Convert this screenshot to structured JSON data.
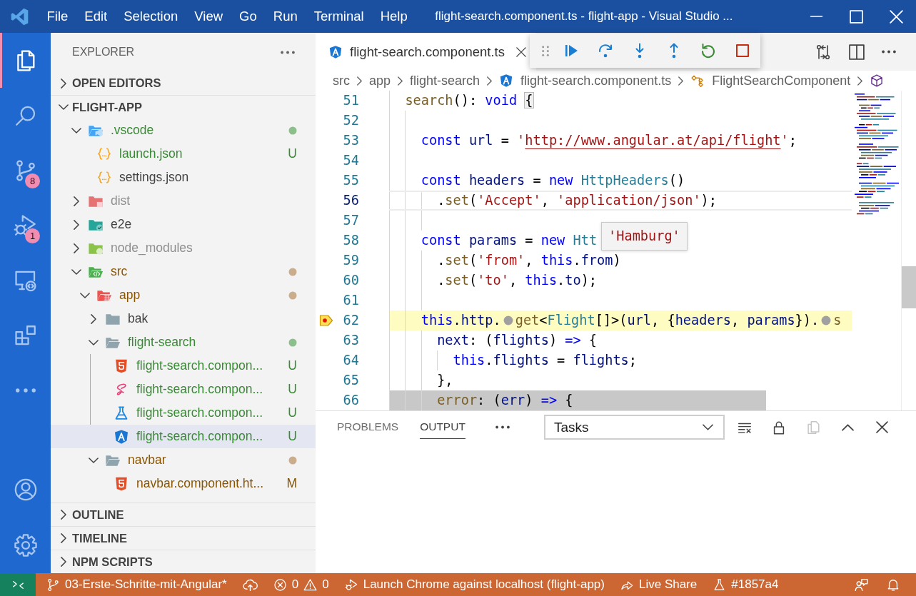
{
  "title_bar": {
    "menu": [
      "File",
      "Edit",
      "Selection",
      "View",
      "Go",
      "Run",
      "Terminal",
      "Help"
    ],
    "title": "flight-search.component.ts - flight-app - Visual Studio ..."
  },
  "activity_bar": {
    "items": [
      {
        "kind": "explorer",
        "selected": true
      },
      {
        "kind": "search",
        "selected": false
      },
      {
        "kind": "scm",
        "selected": false,
        "badge": "8"
      },
      {
        "kind": "debug",
        "selected": false,
        "badge": "1"
      },
      {
        "kind": "remote",
        "selected": false
      },
      {
        "kind": "extensions",
        "selected": false
      },
      {
        "kind": "more",
        "selected": false
      }
    ],
    "bottom": [
      {
        "kind": "account"
      },
      {
        "kind": "settings"
      }
    ]
  },
  "sidebar": {
    "title": "EXPLORER",
    "sections": [
      {
        "label": "OPEN EDITORS",
        "expanded": false
      },
      {
        "label": "FLIGHT-APP",
        "expanded": true,
        "tree": [
          {
            "label": ".vscode",
            "kind": "vscode",
            "expanded": true,
            "untracked": true,
            "modified": false,
            "ignored": false,
            "selected": false,
            "children": [
              {
                "label": "launch.json",
                "kind": "json",
                "untracked": true,
                "modified": false,
                "ignored": false,
                "badge": "U",
                "selected": false
              },
              {
                "label": "settings.json",
                "kind": "json",
                "untracked": false,
                "modified": false,
                "ignored": false,
                "selected": false
              }
            ]
          },
          {
            "label": "dist",
            "kind": "dist",
            "expanded": false,
            "untracked": false,
            "modified": false,
            "ignored": true,
            "selected": false
          },
          {
            "label": "e2e",
            "kind": "e2e",
            "expanded": false,
            "untracked": false,
            "modified": false,
            "ignored": false,
            "selected": false
          },
          {
            "label": "node_modules",
            "kind": "nodemodules",
            "expanded": false,
            "untracked": false,
            "modified": false,
            "ignored": true,
            "selected": false
          },
          {
            "label": "src",
            "kind": "src",
            "expanded": true,
            "untracked": false,
            "modified": true,
            "ignored": false,
            "selected": false,
            "children": [
              {
                "label": "app",
                "kind": "app",
                "expanded": true,
                "untracked": false,
                "modified": true,
                "ignored": false,
                "selected": false,
                "children": [
                  {
                    "label": "bak",
                    "kind": "folder",
                    "expanded": false,
                    "untracked": false,
                    "modified": false,
                    "ignored": false,
                    "selected": false
                  },
                  {
                    "label": "flight-search",
                    "kind": "folder",
                    "expanded": true,
                    "untracked": true,
                    "modified": false,
                    "ignored": false,
                    "selected": false,
                    "children": [
                      {
                        "label": "flight-search.compon...",
                        "kind": "html",
                        "untracked": true,
                        "modified": false,
                        "ignored": false,
                        "badge": "U",
                        "selected": false
                      },
                      {
                        "label": "flight-search.compon...",
                        "kind": "sass",
                        "untracked": true,
                        "modified": false,
                        "ignored": false,
                        "badge": "U",
                        "selected": false
                      },
                      {
                        "label": "flight-search.compon...",
                        "kind": "test",
                        "untracked": true,
                        "modified": false,
                        "ignored": false,
                        "badge": "U",
                        "selected": false
                      },
                      {
                        "label": "flight-search.compon...",
                        "kind": "angular",
                        "untracked": true,
                        "modified": false,
                        "ignored": false,
                        "badge": "U",
                        "selected": true
                      }
                    ]
                  },
                  {
                    "label": "navbar",
                    "kind": "folder",
                    "expanded": true,
                    "untracked": false,
                    "modified": true,
                    "ignored": false,
                    "selected": false,
                    "children": [
                      {
                        "label": "navbar.component.ht...",
                        "kind": "html",
                        "untracked": false,
                        "modified": true,
                        "ignored": false,
                        "badge": "M",
                        "selected": false
                      }
                    ]
                  }
                ]
              }
            ]
          }
        ]
      },
      {
        "label": "OUTLINE",
        "expanded": false
      },
      {
        "label": "TIMELINE",
        "expanded": false
      },
      {
        "label": "NPM SCRIPTS",
        "expanded": false
      }
    ]
  },
  "editor": {
    "tabs": [
      {
        "label": "flight-search.component.ts",
        "kind": "angular",
        "selected": true
      }
    ],
    "breadcrumbs": [
      {
        "label": "src",
        "kind": "folder"
      },
      {
        "label": "app",
        "kind": "folder"
      },
      {
        "label": "flight-search",
        "kind": "folder"
      },
      {
        "label": "flight-search.component.ts",
        "kind": "angular"
      },
      {
        "label": "FlightSearchComponent",
        "kind": "class"
      },
      {
        "kind": "method"
      }
    ],
    "lines": [
      {
        "number": "51",
        "current": false,
        "stopped": false,
        "selected": false,
        "tokens": [
          {
            "text": "  search",
            "kind": "fn"
          },
          {
            "text": "(): ",
            "kind": "plain"
          },
          {
            "text": "void ",
            "kind": "kw"
          },
          {
            "text": "{",
            "kind": "bracket"
          }
        ]
      },
      {
        "number": "52",
        "current": false,
        "stopped": false,
        "selected": false
      },
      {
        "number": "53",
        "current": false,
        "stopped": false,
        "selected": false,
        "tokens": [
          {
            "text": "    const",
            "kind": "kw"
          },
          {
            "text": " url",
            "kind": "var"
          },
          {
            "text": " = ",
            "kind": "plain"
          },
          {
            "text": "'",
            "kind": "str"
          },
          {
            "text": "http://www.angular.at/api/flight",
            "kind": "link"
          },
          {
            "text": "'",
            "kind": "str"
          },
          {
            "text": ";",
            "kind": "plain"
          }
        ]
      },
      {
        "number": "54",
        "current": false,
        "stopped": false,
        "selected": false
      },
      {
        "number": "55",
        "current": false,
        "stopped": false,
        "selected": false,
        "tokens": [
          {
            "text": "    const",
            "kind": "kw"
          },
          {
            "text": " headers",
            "kind": "var"
          },
          {
            "text": " = ",
            "kind": "plain"
          },
          {
            "text": "new",
            "kind": "kw"
          },
          {
            "text": " HttpHeaders",
            "kind": "type"
          },
          {
            "text": "()",
            "kind": "plain"
          }
        ]
      },
      {
        "number": "56",
        "current": true,
        "stopped": false,
        "selected": false,
        "tokens": [
          {
            "text": "      .",
            "kind": "plain"
          },
          {
            "text": "set",
            "kind": "fn"
          },
          {
            "text": "(",
            "kind": "plain"
          },
          {
            "text": "'Accept'",
            "kind": "str"
          },
          {
            "text": ", ",
            "kind": "plain"
          },
          {
            "text": "'application/json'",
            "kind": "str"
          },
          {
            "text": ");",
            "kind": "plain"
          }
        ]
      },
      {
        "number": "57",
        "current": false,
        "stopped": false,
        "selected": false
      },
      {
        "number": "58",
        "current": false,
        "stopped": false,
        "selected": false,
        "tokens": [
          {
            "text": "    const",
            "kind": "kw"
          },
          {
            "text": " params",
            "kind": "var"
          },
          {
            "text": " = ",
            "kind": "plain"
          },
          {
            "text": "new",
            "kind": "kw"
          },
          {
            "text": " Htt",
            "kind": "type"
          }
        ],
        "hover": "'Hamburg'"
      },
      {
        "number": "59",
        "current": false,
        "stopped": false,
        "selected": false,
        "tokens": [
          {
            "text": "      .",
            "kind": "plain"
          },
          {
            "text": "set",
            "kind": "fn"
          },
          {
            "text": "(",
            "kind": "plain"
          },
          {
            "text": "'from'",
            "kind": "str"
          },
          {
            "text": ", ",
            "kind": "plain"
          },
          {
            "text": "this",
            "kind": "kw"
          },
          {
            "text": ".",
            "kind": "plain"
          },
          {
            "text": "from",
            "kind": "var"
          },
          {
            "text": ")",
            "kind": "plain"
          }
        ]
      },
      {
        "number": "60",
        "current": false,
        "stopped": false,
        "selected": false,
        "tokens": [
          {
            "text": "      .",
            "kind": "plain"
          },
          {
            "text": "set",
            "kind": "fn"
          },
          {
            "text": "(",
            "kind": "plain"
          },
          {
            "text": "'to'",
            "kind": "str"
          },
          {
            "text": ", ",
            "kind": "plain"
          },
          {
            "text": "this",
            "kind": "kw"
          },
          {
            "text": ".",
            "kind": "plain"
          },
          {
            "text": "to",
            "kind": "var"
          },
          {
            "text": ");",
            "kind": "plain"
          }
        ]
      },
      {
        "number": "61",
        "current": false,
        "stopped": false,
        "selected": false
      },
      {
        "number": "62",
        "current": false,
        "stopped": true,
        "selected": false,
        "tokens": [
          {
            "text": "    this",
            "kind": "kw"
          },
          {
            "text": ".",
            "kind": "plain"
          },
          {
            "text": "http",
            "kind": "var"
          },
          {
            "text": ".",
            "kind": "plain"
          },
          {
            "kind": "bp"
          },
          {
            "text": "get",
            "kind": "fn"
          },
          {
            "text": "<",
            "kind": "plain"
          },
          {
            "text": "Flight",
            "kind": "type"
          },
          {
            "text": "[]>(",
            "kind": "plain"
          },
          {
            "text": "url",
            "kind": "var"
          },
          {
            "text": ", {",
            "kind": "plain"
          },
          {
            "text": "headers",
            "kind": "var"
          },
          {
            "text": ", ",
            "kind": "plain"
          },
          {
            "text": "params",
            "kind": "var"
          },
          {
            "text": "}).",
            "kind": "plain"
          },
          {
            "kind": "bp"
          },
          {
            "text": "s",
            "kind": "fn"
          }
        ]
      },
      {
        "number": "63",
        "current": false,
        "stopped": false,
        "selected": false,
        "tokens": [
          {
            "text": "      next",
            "kind": "var"
          },
          {
            "text": ": (",
            "kind": "plain"
          },
          {
            "text": "flights",
            "kind": "var"
          },
          {
            "text": ") ",
            "kind": "plain"
          },
          {
            "text": "=>",
            "kind": "kw"
          },
          {
            "text": " {",
            "kind": "plain"
          }
        ]
      },
      {
        "number": "64",
        "current": false,
        "stopped": false,
        "selected": false,
        "tokens": [
          {
            "text": "        this",
            "kind": "kw"
          },
          {
            "text": ".",
            "kind": "plain"
          },
          {
            "text": "flights",
            "kind": "var"
          },
          {
            "text": " = ",
            "kind": "plain"
          },
          {
            "text": "flights",
            "kind": "var"
          },
          {
            "text": ";",
            "kind": "plain"
          }
        ]
      },
      {
        "number": "65",
        "current": false,
        "stopped": false,
        "selected": false,
        "tokens": [
          {
            "text": "      },",
            "kind": "plain"
          }
        ]
      },
      {
        "number": "66",
        "current": false,
        "stopped": false,
        "selected": true,
        "tokens": [
          {
            "text": "      error",
            "kind": "fn"
          },
          {
            "text": ": (",
            "kind": "plain"
          },
          {
            "text": "err",
            "kind": "var"
          },
          {
            "text": ") ",
            "kind": "plain"
          },
          {
            "text": "=>",
            "kind": "kw"
          },
          {
            "text": " {",
            "kind": "plain"
          }
        ]
      }
    ]
  },
  "panel": {
    "tabs": [
      {
        "label": "PROBLEMS",
        "selected": false
      },
      {
        "label": "OUTPUT",
        "selected": true
      }
    ],
    "dropdown": {
      "value": "Tasks"
    },
    "actions": [
      {
        "kind": "clear",
        "disabled": false
      },
      {
        "kind": "lock",
        "disabled": false
      },
      {
        "kind": "copy",
        "disabled": true
      },
      {
        "kind": "maximize",
        "disabled": false
      },
      {
        "kind": "close",
        "disabled": false
      }
    ]
  },
  "status_bar": {
    "items": [
      {
        "kind": "remote"
      },
      {
        "kind": "branch",
        "text": "03-Erste-Schritte-mit-Angular*"
      },
      {
        "kind": "sync"
      },
      {
        "kind": "problems",
        "errors": "0",
        "warnings": "0"
      },
      {
        "kind": "debug",
        "text": "Launch Chrome against localhost (flight-app)"
      },
      {
        "kind": "liveshare",
        "text": "Live Share"
      },
      {
        "kind": "commit",
        "text": "#1857a4"
      }
    ]
  }
}
